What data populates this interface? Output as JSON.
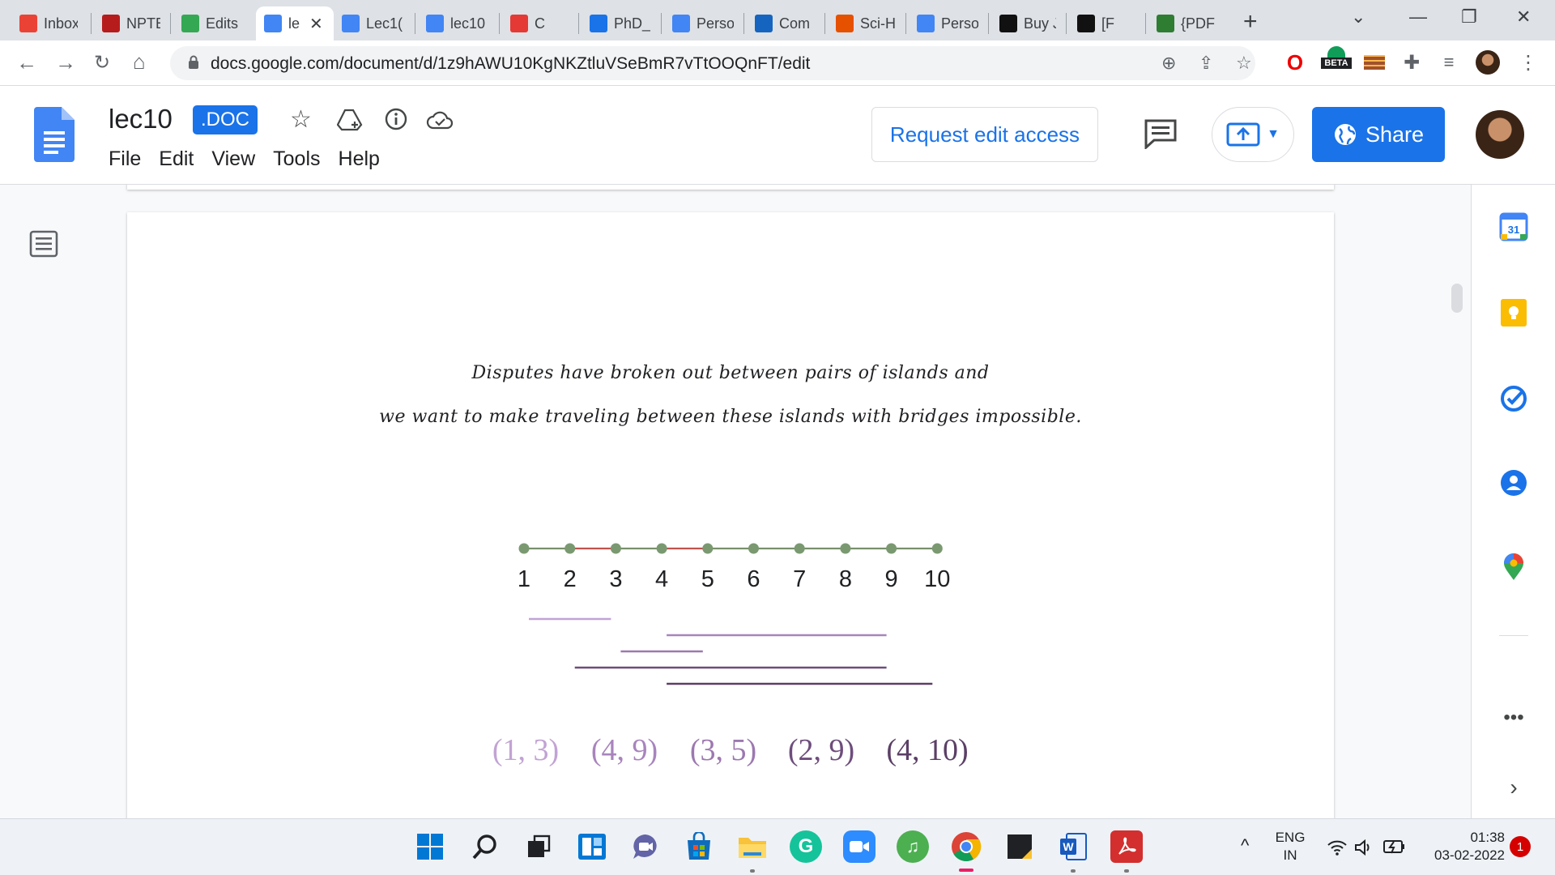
{
  "browser": {
    "tabs": [
      {
        "label": "Inbox",
        "icon": "gmail-icon",
        "color": "#ea4335"
      },
      {
        "label": "NPTE",
        "icon": "nptel-icon",
        "color": "#b71c1c"
      },
      {
        "label": "Edits",
        "icon": "google-drive-icon",
        "color": "#34a853"
      },
      {
        "label": "le",
        "icon": "google-docs-icon",
        "color": "#4285f4",
        "active": true
      },
      {
        "label": "Lec1(",
        "icon": "google-docs-icon",
        "color": "#4285f4"
      },
      {
        "label": "lec10",
        "icon": "google-docs-icon",
        "color": "#4285f4"
      },
      {
        "label": "C",
        "icon": "gradeup-icon",
        "color": "#e53935"
      },
      {
        "label": "PhD_",
        "icon": "file-icon",
        "color": "#1a73e8"
      },
      {
        "label": "Perso",
        "icon": "google-docs-icon",
        "color": "#4285f4"
      },
      {
        "label": "Com",
        "icon": "link-icon",
        "color": "#1565c0"
      },
      {
        "label": "Sci-H",
        "icon": "sci-hub-icon",
        "color": "#e65100"
      },
      {
        "label": "Perso",
        "icon": "google-docs-icon",
        "color": "#4285f4"
      },
      {
        "label": "Buy J",
        "icon": "amazon-icon",
        "color": "#111111"
      },
      {
        "label": "[F",
        "icon": "book-icon",
        "color": "#111111"
      },
      {
        "label": "{PDF",
        "icon": "pdf-site-icon",
        "color": "#2e7d32"
      }
    ],
    "url": "docs.google.com/document/d/1z9hAWU10KgNKZtluVSeBmR7vTtOOQnFT/edit",
    "beta_label": "BETA"
  },
  "doc": {
    "title": "lec10",
    "badge": ".DOC",
    "menu": [
      "File",
      "Edit",
      "View",
      "Tools",
      "Help"
    ],
    "request_edit_label": "Request edit access",
    "share_label": "Share",
    "accent": "#1a73e8"
  },
  "content": {
    "text_line_1": "Disputes have broken out between pairs of islands and",
    "text_line_2": "we want to make traveling between these islands with bridges impossible.",
    "islands": [
      "1",
      "2",
      "3",
      "4",
      "5",
      "6",
      "7",
      "8",
      "9",
      "10"
    ],
    "bridge_colors": [
      "#78906b",
      "#c0534e",
      "#78906b",
      "#c0534e",
      "#78906b",
      "#78906b",
      "#78906b",
      "#78906b",
      "#78906b"
    ],
    "node_color": "#7a9971",
    "disputes": [
      {
        "label": "(1, 3)",
        "from": 1,
        "to": 3,
        "color": "#c2a3d4"
      },
      {
        "label": "(4, 9)",
        "from": 4,
        "to": 9,
        "color": "#a884bd"
      },
      {
        "label": "(3, 5)",
        "from": 3,
        "to": 5,
        "color": "#9c78b0"
      },
      {
        "label": "(2, 9)",
        "from": 2,
        "to": 9,
        "color": "#6e4d7c"
      },
      {
        "label": "(4, 10)",
        "from": 4,
        "to": 10,
        "color": "#5b3f66"
      }
    ]
  },
  "taskbar": {
    "lang_1": "ENG",
    "lang_2": "IN",
    "time": "01:38",
    "date": "03-02-2022",
    "notifications": "1"
  }
}
